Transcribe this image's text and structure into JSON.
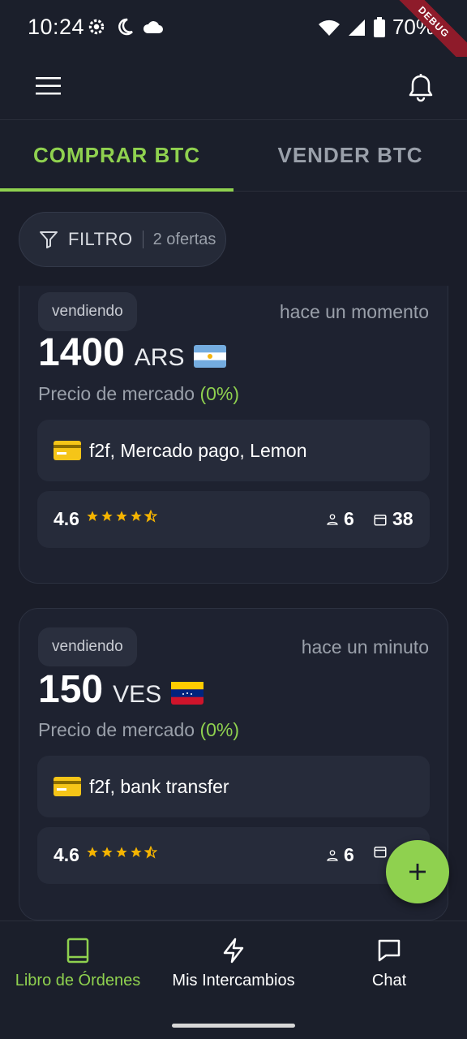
{
  "status_bar": {
    "time": "10:24",
    "battery": "70%",
    "debug_label": "DEBUG"
  },
  "tabs": [
    {
      "label": "COMPRAR BTC",
      "active": true
    },
    {
      "label": "VENDER BTC",
      "active": false
    }
  ],
  "filter": {
    "label": "FILTRO",
    "count_text": "2 ofertas"
  },
  "offers": [
    {
      "side": "vendiendo",
      "time_ago": "hace un momento",
      "amount": "1400",
      "currency": "ARS",
      "market_label": "Precio de mercado",
      "market_pct": "(0%)",
      "payment": "f2f, Mercado pago, Lemon",
      "rating": "4.6",
      "trades": "6",
      "days": "38"
    },
    {
      "side": "vendiendo",
      "time_ago": "hace un minuto",
      "amount": "150",
      "currency": "VES",
      "market_label": "Precio de mercado",
      "market_pct": "(0%)",
      "payment": "f2f, bank transfer",
      "rating": "4.6",
      "trades": "6",
      "days": ""
    }
  ],
  "bottom_nav": [
    {
      "label": "Libro de Órdenes",
      "icon": "book-icon",
      "active": true
    },
    {
      "label": "Mis Intercambios",
      "icon": "lightning-icon",
      "active": false
    },
    {
      "label": "Chat",
      "icon": "chat-icon",
      "active": false
    }
  ],
  "colors": {
    "accent": "#8fd14f",
    "background": "#1a1d29",
    "card": "#1e2230",
    "star": "#f5b400"
  }
}
